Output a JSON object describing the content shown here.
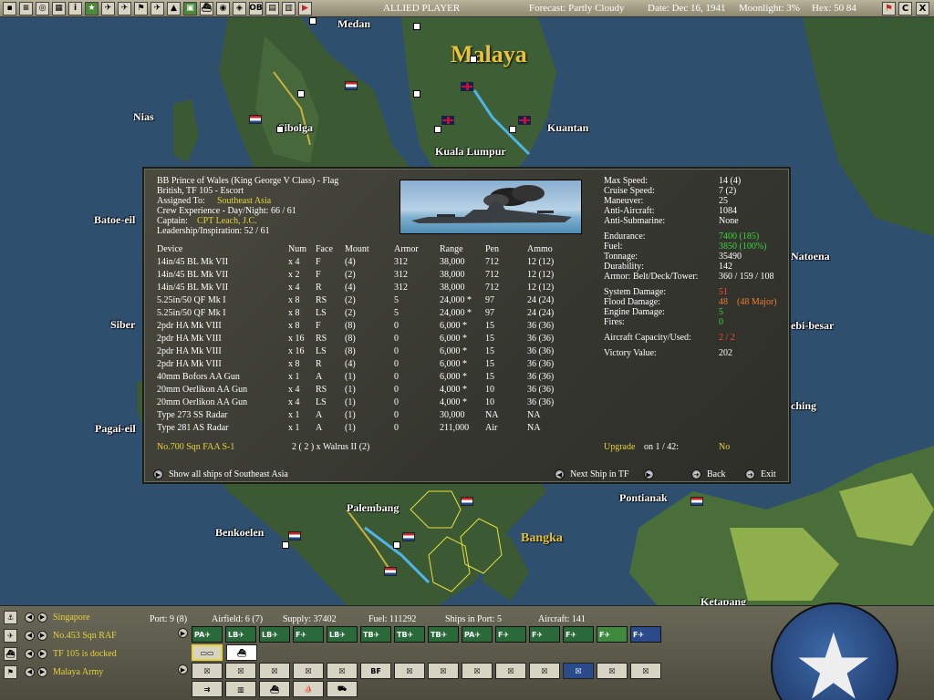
{
  "topbar": {
    "icons": [
      "toolbar-icon-1",
      "toolbar-icon-2",
      "toolbar-icon-3",
      "toolbar-icon-4",
      "toolbar-icon-5",
      "toolbar-icon-6",
      "toolbar-icon-7",
      "toolbar-icon-8",
      "toolbar-icon-9",
      "toolbar-icon-10",
      "toolbar-icon-11",
      "toolbar-icon-12",
      "toolbar-icon-13",
      "toolbar-icon-14",
      "toolbar-icon-15",
      "toolbar-icon-16",
      "toolbar-icon-17",
      "toolbar-icon-18",
      "toolbar-icon-19",
      "toolbar-icon-20",
      "toolbar-icon-21",
      "toolbar-icon-22",
      "toolbar-icon-23"
    ],
    "ob_label": "OB",
    "player": "ALLIED PLAYER",
    "forecast": "Forecast: Partly Cloudy",
    "date": "Date: Dec 16, 1941",
    "moonlight": "Moonlight: 3%",
    "hex": "Hex: 50 84",
    "right_buttons": [
      "C",
      "X"
    ]
  },
  "map": {
    "region": "Malaya",
    "places": [
      "Medan",
      "Nias",
      "Sibolga",
      "Kuala Lumpur",
      "Kuantan",
      "Batoe-eil",
      "Siber",
      "Pagai-eil",
      "Benkoelen",
      "Palembang",
      "Pontianak",
      "Bangka",
      "Ketapang",
      "Natoena",
      "ebi-besar",
      "ching"
    ],
    "colors": {
      "sea": "#2f4f6e",
      "land": "#3a5a34"
    }
  },
  "ship": {
    "title": "BB Prince of Wales (King George V Class) - Flag",
    "tf": "British, TF 105 - Escort",
    "assigned_label": "Assigned To:",
    "assigned_value": "Southeast Asia",
    "crew": "Crew Experience - Day/Night: 66 / 61",
    "captain_label": "Captain:",
    "captain_value": "CPT Leach, J.C.",
    "leadership": "Leadership/Inspiration: 52 / 61",
    "stats": [
      {
        "label": "Max Speed:",
        "value": "14 (4)",
        "color": "w"
      },
      {
        "label": "Cruise Speed:",
        "value": "7 (2)",
        "color": "w"
      },
      {
        "label": "Maneuver:",
        "value": "25",
        "color": "w"
      },
      {
        "label": "Anti-Aircraft:",
        "value": "1084",
        "color": "w"
      },
      {
        "label": "Anti-Submarine:",
        "value": "None",
        "color": "w"
      },
      {
        "label": "Endurance:",
        "value": "7400 (185)",
        "color": "g"
      },
      {
        "label": "Fuel:",
        "value": "3850 (100%)",
        "color": "g"
      },
      {
        "label": "Tonnage:",
        "value": "35490",
        "color": "w"
      },
      {
        "label": "Durability:",
        "value": "142",
        "color": "w"
      },
      {
        "label": "Armor: Belt/Deck/Tower:",
        "value": "360 / 159 / 108",
        "color": "w"
      },
      {
        "label": "System Damage:",
        "value": "51",
        "color": "r"
      },
      {
        "label": "Flood Damage:",
        "value": "48",
        "value2": "(48 Major)",
        "color": "o"
      },
      {
        "label": "Engine Damage:",
        "value": "5",
        "color": "g"
      },
      {
        "label": "Fires:",
        "value": "0",
        "color": "g"
      },
      {
        "label": "Aircraft Capacity/Used:",
        "value": "2 / 2",
        "color": "r"
      },
      {
        "label": "Victory Value:",
        "value": "202",
        "color": "w"
      }
    ],
    "device_headers": [
      "Device",
      "Num",
      "Face",
      "Mount",
      "Armor",
      "Range",
      "Pen",
      "Ammo"
    ],
    "devices": [
      [
        "14in/45 BL Mk VII",
        "x 4",
        "F",
        "(4)",
        "312",
        "38,000",
        "712",
        "12 (12)"
      ],
      [
        "14in/45 BL Mk VII",
        "x 2",
        "F",
        "(2)",
        "312",
        "38,000",
        "712",
        "12 (12)"
      ],
      [
        "14in/45 BL Mk VII",
        "x 4",
        "R",
        "(4)",
        "312",
        "38,000",
        "712",
        "12 (12)"
      ],
      [
        "5.25in/50 QF Mk I",
        "x 8",
        "RS",
        "(2)",
        "5",
        "24,000 *",
        "97",
        "24 (24)"
      ],
      [
        "5.25in/50 QF Mk I",
        "x 8",
        "LS",
        "(2)",
        "5",
        "24,000 *",
        "97",
        "24 (24)"
      ],
      [
        "2pdr HA Mk VIII",
        "x 8",
        "F",
        "(8)",
        "0",
        "6,000 *",
        "15",
        "36 (36)"
      ],
      [
        "2pdr HA Mk VIII",
        "x 16",
        "RS",
        "(8)",
        "0",
        "6,000 *",
        "15",
        "36 (36)"
      ],
      [
        "2pdr HA Mk VIII",
        "x 16",
        "LS",
        "(8)",
        "0",
        "6,000 *",
        "15",
        "36 (36)"
      ],
      [
        "2pdr HA Mk VIII",
        "x 8",
        "R",
        "(4)",
        "0",
        "6,000 *",
        "15",
        "36 (36)"
      ],
      [
        "40mm Bofors AA Gun",
        "x 1",
        "A",
        "(1)",
        "0",
        "6,000 *",
        "15",
        "36 (36)"
      ],
      [
        "20mm Oerlikon AA Gun",
        "x 4",
        "RS",
        "(1)",
        "0",
        "4,000 *",
        "10",
        "36 (36)"
      ],
      [
        "20mm Oerlikon AA Gun",
        "x 4",
        "LS",
        "(1)",
        "0",
        "4,000 *",
        "10",
        "36 (36)"
      ],
      [
        "Type 273 SS Radar",
        "x 1",
        "A",
        "(1)",
        "0",
        "30,000",
        "NA",
        "NA"
      ],
      [
        "Type 281 AS Radar",
        "x 1",
        "A",
        "(1)",
        "0",
        "211,000",
        "Air",
        "NA"
      ]
    ],
    "air_unit": "No.700 Sqn FAA S-1",
    "air_unit_ac": "2 ( 2 ) x Walrus II (2)",
    "upgrade_label": "Upgrade",
    "upgrade_on": "on 1 / 42:",
    "upgrade_value": "No",
    "show_all": "Show all ships of Southeast Asia",
    "next_ship": "Next Ship in TF",
    "back": "Back",
    "exit": "Exit"
  },
  "bottom": {
    "lines": [
      {
        "label": "Singapore",
        "icon": "anchor-icon"
      },
      {
        "label": "No.453 Sqn RAF",
        "icon": "plane-icon"
      },
      {
        "label": "TF 105 is docked",
        "icon": "ship-icon"
      },
      {
        "label": "Malaya Army",
        "icon": "flag-icon"
      }
    ],
    "stats": [
      "Port: 9 (8)",
      "Airfield: 6 (7)",
      "Supply: 37402",
      "Fuel: 111292",
      "Ships in Port: 5",
      "Aircraft: 141"
    ],
    "air_types": [
      "PA",
      "LB",
      "LB",
      "F",
      "LB",
      "TB",
      "TB",
      "TB",
      "PA",
      "F",
      "F",
      "F",
      "F",
      "F"
    ],
    "unit_types": [
      "",
      "",
      "",
      "",
      "",
      "BF",
      "",
      "",
      "",
      "",
      "",
      "",
      "",
      ""
    ]
  }
}
